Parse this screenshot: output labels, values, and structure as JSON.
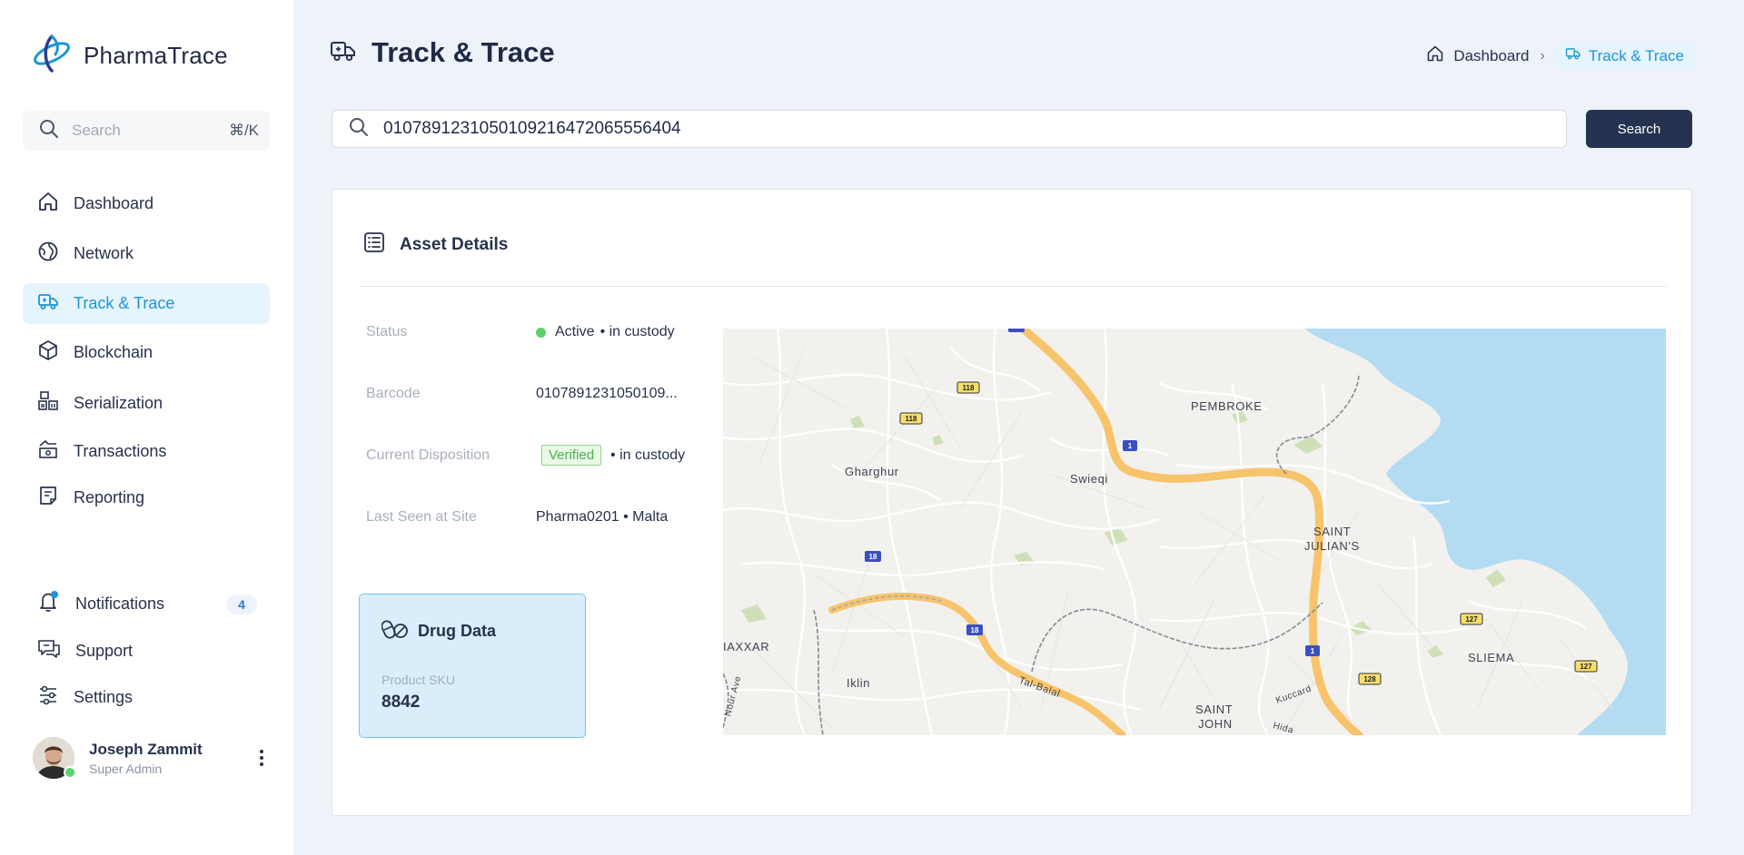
{
  "sidebar": {
    "brand": "PharmaTrace",
    "search_placeholder": "Search",
    "search_shortcut": "⌘/K",
    "items": [
      {
        "label": "Dashboard",
        "icon": "home-icon"
      },
      {
        "label": "Network",
        "icon": "globe-icon"
      },
      {
        "label": "Track & Trace",
        "icon": "truck-icon",
        "active": true
      },
      {
        "label": "Blockchain",
        "icon": "cube-icon"
      },
      {
        "label": "Serialization",
        "icon": "barcode-boxes-icon"
      },
      {
        "label": "Transactions",
        "icon": "transfer-icon"
      },
      {
        "label": "Reporting",
        "icon": "report-icon"
      }
    ],
    "bottom_items": [
      {
        "label": "Notifications",
        "icon": "bell-icon",
        "badge": "4"
      },
      {
        "label": "Support",
        "icon": "chat-icon"
      },
      {
        "label": "Settings",
        "icon": "sliders-icon"
      }
    ],
    "user": {
      "name": "Joseph Zammit",
      "role": "Super Admin"
    }
  },
  "header": {
    "title": "Track & Trace",
    "breadcrumb": {
      "home": "Dashboard",
      "current": "Track & Trace"
    }
  },
  "search": {
    "value": "01078912310501092164720655564​04",
    "button": "Search"
  },
  "asset": {
    "title": "Asset Details",
    "fields": {
      "status_label": "Status",
      "status_value": "Active",
      "status_suffix": "• in custody",
      "barcode_label": "Barcode",
      "barcode_value": "0107891231050109...",
      "disposition_label": "Current Disposition",
      "disposition_badge": "Verified",
      "disposition_suffix": "• in custody",
      "last_seen_label": "Last Seen at Site",
      "last_seen_value": "Pharma0201 • Malta"
    },
    "drug": {
      "title": "Drug Data",
      "sku_label": "Product SKU",
      "sku_value": "8842"
    }
  },
  "map": {
    "places": [
      "PEMBROKE",
      "Gharghur",
      "Swieqi",
      "SAINT",
      "JULIAN'S",
      "IAXXAR",
      "Iklin",
      "SAINT",
      "JOHN",
      "SLIEMA",
      "Tal-Balal",
      "Kuccard",
      "Hida",
      "Nour Ave"
    ],
    "road_shields": [
      "118",
      "118",
      "1",
      "18",
      "18",
      "1",
      "127",
      "128",
      "127"
    ]
  },
  "colors": {
    "accent": "#1e95d3",
    "primary_button": "#263350",
    "status_green": "#5cd26a",
    "water": "#b3dcf2",
    "highway": "#f7c46b"
  }
}
